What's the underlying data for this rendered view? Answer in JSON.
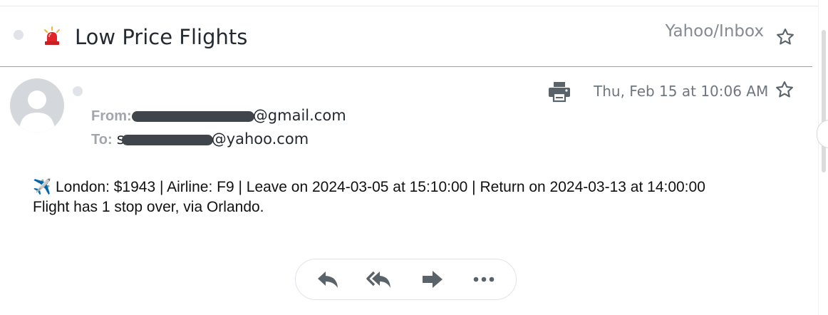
{
  "subject": {
    "title": "Low Price Flights",
    "folder": "Yahoo/Inbox",
    "icon": "siren-icon"
  },
  "message": {
    "from_label": "From:",
    "from_visible_suffix": "@gmail.com",
    "to_label": "To:",
    "to_visible_prefix": "s",
    "to_visible_suffix": "@yahoo.com",
    "date": "Thu, Feb 15 at 10:06 AM",
    "body": {
      "icon": "✈️",
      "line1": "London: $1943 | Airline: F9 | Leave on 2024-03-05 at 15:10:00 | Return on 2024-03-13 at 14:00:00",
      "line2": "Flight has 1 stop over, via Orlando."
    }
  },
  "actions": [
    "reply",
    "reply-all",
    "forward",
    "more"
  ],
  "colors": {
    "icon_gray": "#5b636a",
    "siren_red": "#e0262b",
    "redaction": "#3f454b",
    "folder_text": "#828a93"
  }
}
